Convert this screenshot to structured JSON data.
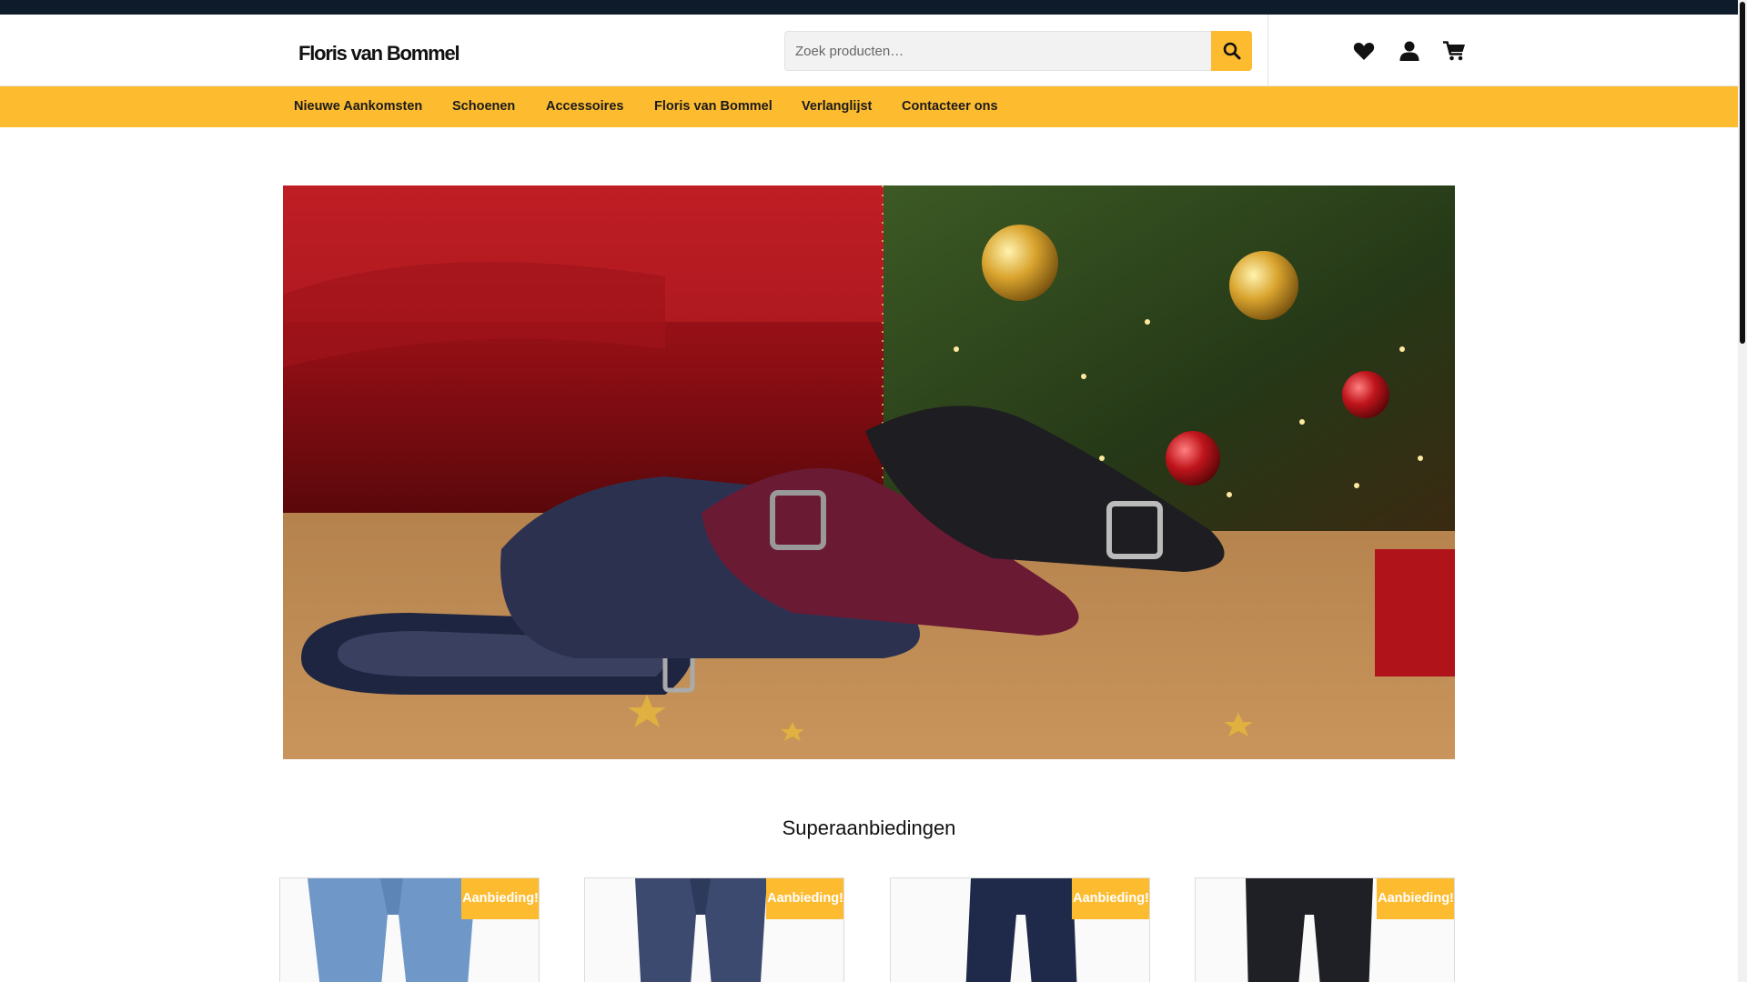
{
  "header": {
    "logo_text": "Floris van Bommel",
    "search": {
      "placeholder": "Zoek producten…",
      "button_icon": "search-icon"
    },
    "icons": [
      "heart-icon",
      "user-icon",
      "cart-icon"
    ]
  },
  "nav": {
    "items": [
      {
        "label": "Nieuwe Aankomsten"
      },
      {
        "label": "Schoenen"
      },
      {
        "label": "Accessoires"
      },
      {
        "label": "Floris van Bommel"
      },
      {
        "label": "Verlanglijst"
      },
      {
        "label": "Contacteer ons"
      }
    ]
  },
  "colors": {
    "accent": "#fdbb30",
    "topbar": "#0e1b2b"
  },
  "main": {
    "hero_icon": "hero-christmas-shoes-image",
    "section_title": "Superaanbiedingen",
    "products": [
      {
        "badge": "Aanbieding!",
        "image": "light-blue-jeans"
      },
      {
        "badge": "Aanbieding!",
        "image": "dark-blue-jeans"
      },
      {
        "badge": "Aanbieding!",
        "image": "navy-chinos"
      },
      {
        "badge": "Aanbieding!",
        "image": "black-jeans"
      }
    ]
  }
}
